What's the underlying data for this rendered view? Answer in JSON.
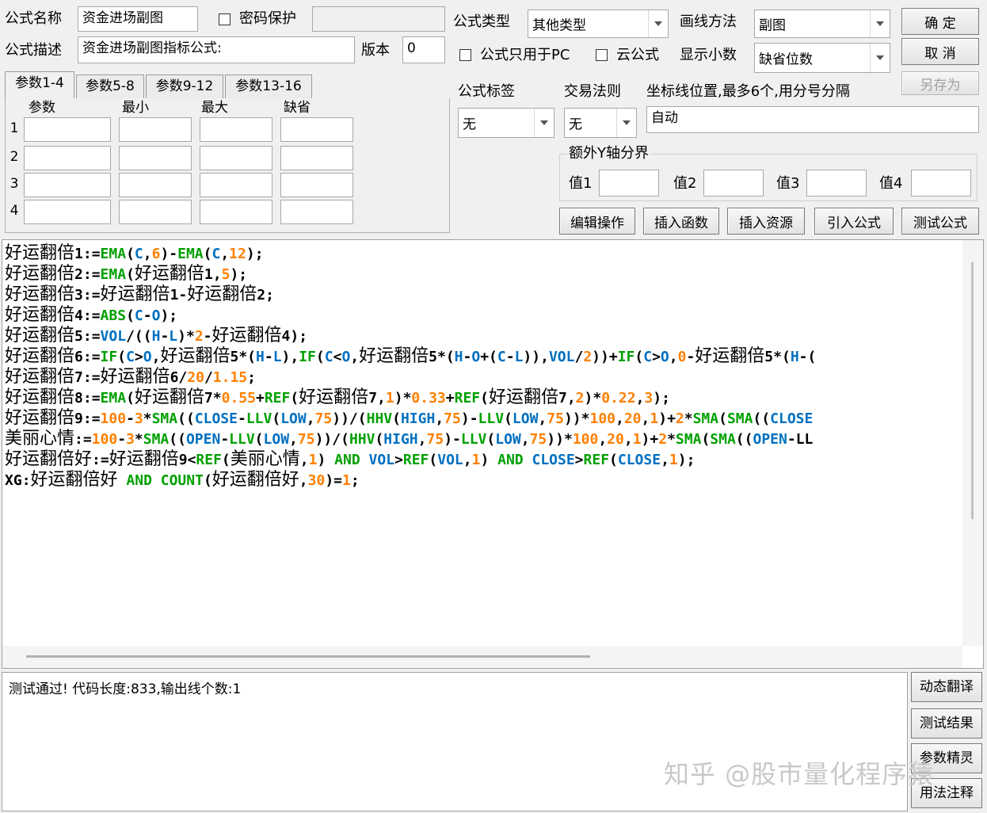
{
  "header": {
    "name_label": "公式名称",
    "name_value": "资金进场副图",
    "password_label": "密码保护",
    "desc_label": "公式描述",
    "desc_value": "资金进场副图指标公式:",
    "version_label": "版本",
    "version_value": "0",
    "type_label": "公式类型",
    "type_value": "其他类型",
    "draw_label": "画线方法",
    "draw_value": "副图",
    "pc_only_label": "公式只用于PC",
    "cloud_label": "云公式",
    "decimals_label": "显示小数",
    "decimals_value": "缺省位数",
    "ok_label": "确  定",
    "cancel_label": "取  消",
    "saveas_label": "另存为"
  },
  "params": {
    "tabs": [
      "参数1-4",
      "参数5-8",
      "参数9-12",
      "参数13-16"
    ],
    "columns": [
      "参数",
      "最小",
      "最大",
      "缺省"
    ],
    "rows": [
      "1",
      "2",
      "3",
      "4"
    ]
  },
  "options": {
    "tag_label": "公式标签",
    "tag_value": "无",
    "rule_label": "交易法则",
    "rule_value": "无",
    "axis_label": "坐标线位置,最多6个,用分号分隔",
    "axis_value": "自动",
    "extra_y_label": "额外Y轴分界",
    "v1_label": "值1",
    "v2_label": "值2",
    "v3_label": "值3",
    "v4_label": "值4"
  },
  "toolbar": {
    "edit_ops": "编辑操作",
    "insert_func": "插入函数",
    "insert_res": "插入资源",
    "import_formula": "引入公式",
    "test_formula": "测试公式"
  },
  "code": [
    "好运翻倍1:=EMA(C,6)-EMA(C,12);",
    "好运翻倍2:=EMA(好运翻倍1,5);",
    "好运翻倍3:=好运翻倍1-好运翻倍2;",
    "好运翻倍4:=ABS(C-O);",
    "好运翻倍5:=VOL/((H-L)*2-好运翻倍4);",
    "好运翻倍6:=IF(C>O,好运翻倍5*(H-L),IF(C<O,好运翻倍5*(H-O+(C-L)),VOL/2))+IF(C>O,0-好运翻倍5*(H-(",
    "好运翻倍7:=好运翻倍6/20/1.15;",
    "好运翻倍8:=EMA(好运翻倍7*0.55+REF(好运翻倍7,1)*0.33+REF(好运翻倍7,2)*0.22,3);",
    "好运翻倍9:=100-3*SMA((CLOSE-LLV(LOW,75))/(HHV(HIGH,75)-LLV(LOW,75))*100,20,1)+2*SMA(SMA((CLOSE",
    "美丽心情:=100-3*SMA((OPEN-LLV(LOW,75))/(HHV(HIGH,75)-LLV(LOW,75))*100,20,1)+2*SMA(SMA((OPEN-LL",
    "好运翻倍好:=好运翻倍9<REF(美丽心情,1) AND VOL>REF(VOL,1) AND CLOSE>REF(CLOSE,1);",
    "XG:好运翻倍好 AND COUNT(好运翻倍好,30)=1;"
  ],
  "output": {
    "message": "测试通过! 代码长度:833,输出线个数:1"
  },
  "side_buttons": [
    "动态翻译",
    "测试结果",
    "参数精灵",
    "用法注释"
  ],
  "watermark": "知乎 @股市量化程序猿",
  "colors": {
    "function": "#00a000",
    "number": "#ff8000",
    "keyword": "#0070c0",
    "text": "#000000"
  }
}
